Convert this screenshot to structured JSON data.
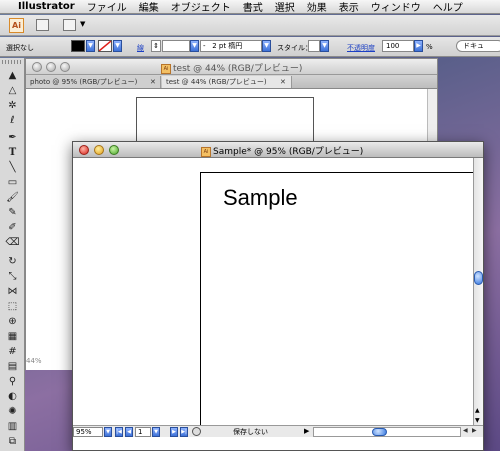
{
  "menubar": {
    "apple_symbol": "",
    "app_name": "Illustrator",
    "items": [
      "ファイル",
      "編集",
      "オブジェクト",
      "書式",
      "選択",
      "効果",
      "表示",
      "ウィンドウ",
      "ヘルプ"
    ]
  },
  "app_toolbar": {
    "logo": "Ai",
    "dropdown_arrow": "▼"
  },
  "control_panel": {
    "selection_label": "選択なし",
    "stroke_label": "線",
    "stroke_weight_value": "",
    "brush_value": "2 pt 楕円",
    "style_label": "スタイル：",
    "opacity_label": "不透明度",
    "opacity_value": "100",
    "opacity_unit": "%",
    "right_panel": "ドキュ",
    "colors": {
      "fill": "#000000",
      "link": "#1b3fc4"
    }
  },
  "background_window": {
    "title": "test @ 44% (RGB/プレビュー)",
    "doc_icon": "Ai",
    "tabs": [
      {
        "label": "photo @ 95% (RGB/プレビュー)",
        "close": "✕"
      },
      {
        "label": "test @ 44% (RGB/プレビュー)",
        "close": "✕"
      }
    ],
    "zoom": "44%"
  },
  "front_window": {
    "title": "Sample* @ 95% (RGB/プレビュー)",
    "doc_icon": "Ai",
    "artboard_text": "Sample",
    "status": {
      "zoom": "95%",
      "page": "1",
      "status_text": "保存しない",
      "first_icon": "|◀",
      "prev_icon": "◀",
      "next_icon": "▶",
      "last_icon": "▶|",
      "menu_arrow": "▶"
    }
  },
  "tools": [
    {
      "name": "selection-tool-icon",
      "glyph": "▲"
    },
    {
      "name": "direct-selection-tool-icon",
      "glyph": "△"
    },
    {
      "name": "magic-wand-tool-icon",
      "glyph": "✲"
    },
    {
      "name": "lasso-tool-icon",
      "glyph": "ℓ"
    },
    {
      "name": "pen-tool-icon",
      "glyph": "✒"
    },
    {
      "name": "type-tool-icon",
      "glyph": "T"
    },
    {
      "name": "line-tool-icon",
      "glyph": "╲"
    },
    {
      "name": "rectangle-tool-icon",
      "glyph": "▭"
    },
    {
      "name": "paintbrush-tool-icon",
      "glyph": "🖌"
    },
    {
      "name": "pencil-tool-icon",
      "glyph": "✎"
    },
    {
      "name": "blob-brush-tool-icon",
      "glyph": "✐"
    },
    {
      "name": "eraser-tool-icon",
      "glyph": "⌫"
    },
    {
      "name": "rotate-tool-icon",
      "glyph": "↻"
    },
    {
      "name": "scale-tool-icon",
      "glyph": "⤡"
    },
    {
      "name": "width-tool-icon",
      "glyph": "⋈"
    },
    {
      "name": "free-transform-tool-icon",
      "glyph": "⬚"
    },
    {
      "name": "shape-builder-tool-icon",
      "glyph": "⊕"
    },
    {
      "name": "perspective-grid-tool-icon",
      "glyph": "▦"
    },
    {
      "name": "mesh-tool-icon",
      "glyph": "#"
    },
    {
      "name": "gradient-tool-icon",
      "glyph": "▤"
    },
    {
      "name": "eyedropper-tool-icon",
      "glyph": "⚲"
    },
    {
      "name": "blend-tool-icon",
      "glyph": "◐"
    },
    {
      "name": "symbol-sprayer-tool-icon",
      "glyph": "✺"
    },
    {
      "name": "column-graph-tool-icon",
      "glyph": "▥"
    },
    {
      "name": "artboard-tool-icon",
      "glyph": "⧉"
    }
  ]
}
